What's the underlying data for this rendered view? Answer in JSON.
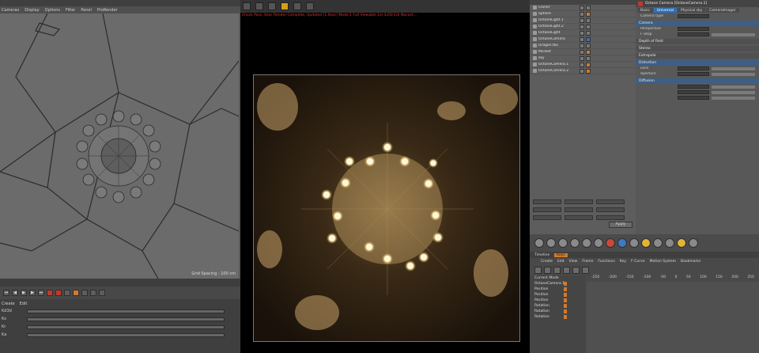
{
  "left_viewport": {
    "menu": [
      "Cameras",
      "Display",
      "Options",
      "Filter",
      "Panel",
      "ProRender"
    ],
    "grid_spacing": "Grid Spacing : 100 cm"
  },
  "material_panel": {
    "tabs": [
      "Create",
      "Edit"
    ],
    "rows": [
      "Kd3d",
      "Ks",
      "Kr",
      "Ka"
    ]
  },
  "render_view": {
    "status": "Check Pass: 0sec  Render:Complete, Updated [1.0sec]  Mode:1 Full  Viewable 2xl  3x50 Edr  Nocost..."
  },
  "object_manager": {
    "objects": [
      {
        "name": "Cloner"
      },
      {
        "name": "Sphere"
      },
      {
        "name": "OctaneLight.1"
      },
      {
        "name": "OctaneLight.2"
      },
      {
        "name": "OctaneLight"
      },
      {
        "name": "OctaneCamera"
      },
      {
        "name": "Dragon.fbx"
      },
      {
        "name": "MoText"
      },
      {
        "name": "sky"
      },
      {
        "name": "OctaneCamera.1"
      },
      {
        "name": "OctaneCamera.2"
      }
    ],
    "apply_label": "Apply"
  },
  "attribute_manager": {
    "title": "Octane Camera [OctaneCamera.1]",
    "tabs": [
      "Basic",
      "Universal",
      "Physical sky",
      "CameraImager"
    ],
    "rows": [
      "Camera type",
      "Perspective",
      "F-Stop",
      "Lens",
      "Aperture"
    ],
    "sections": [
      "Camera",
      "Depth of field",
      "Stereo",
      "Extrapola",
      "Distortion",
      "Diffusion"
    ]
  },
  "timeline": {
    "tabs": [
      "Timeline",
      "Keys"
    ],
    "menu": [
      "Create",
      "Edit",
      "View",
      "Frame",
      "Functions",
      "Key",
      "F-Curve",
      "Motion System",
      "Bookmarks"
    ],
    "header": "Current Mode",
    "tracks": [
      "OctaneCamera.1",
      "Position",
      "Position",
      "Position",
      "Rotation",
      "Rotation",
      "Rotation"
    ],
    "ruler": [
      "-250",
      "-200",
      "-150",
      "-100",
      "-50",
      "0",
      "50",
      "100",
      "150",
      "200",
      "250"
    ]
  },
  "colors": {
    "accent": "#2f6fb6",
    "highlight": "#d27a2c",
    "render_bg": "#2b1b10",
    "lights": "#fff3cc"
  }
}
